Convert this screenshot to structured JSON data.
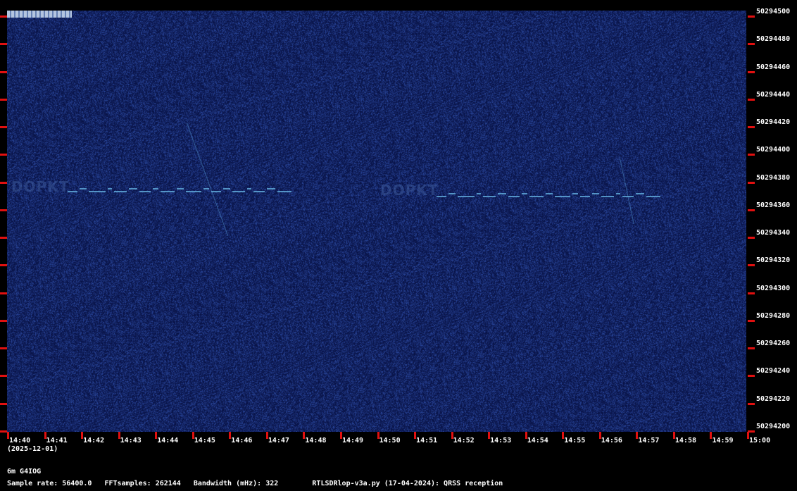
{
  "corner_mark": "",
  "y_labels": [
    "50294500",
    "50294480",
    "50294460",
    "50294440",
    "50294420",
    "50294400",
    "50294380",
    "50294360",
    "50294340",
    "50294320",
    "50294300",
    "50294280",
    "50294260",
    "50294240",
    "50294220",
    "50294200"
  ],
  "x_labels": [
    "14:40",
    "14:41",
    "14:42",
    "14:43",
    "14:44",
    "14:45",
    "14:46",
    "14:47",
    "14:48",
    "14:49",
    "14:50",
    "14:51",
    "14:52",
    "14:53",
    "14:54",
    "14:55",
    "14:56",
    "14:57",
    "14:58",
    "14:59",
    "15:00"
  ],
  "date": "(2025-12-01)",
  "band": "6m G4IOG",
  "footer": {
    "sample_rate": "Sample rate: 56400.0",
    "fft_samples": "FFTsamples: 262144",
    "bandwidth": "Bandwidth (mHz): 322",
    "program": "RTLSDRlop-v3a.py (17-04-2024): QRSS reception"
  },
  "ghost_callsign": "DOPKT",
  "colors": {
    "background": "#0a1650",
    "tick": "#e01010",
    "signal": "#5fa8d8"
  }
}
